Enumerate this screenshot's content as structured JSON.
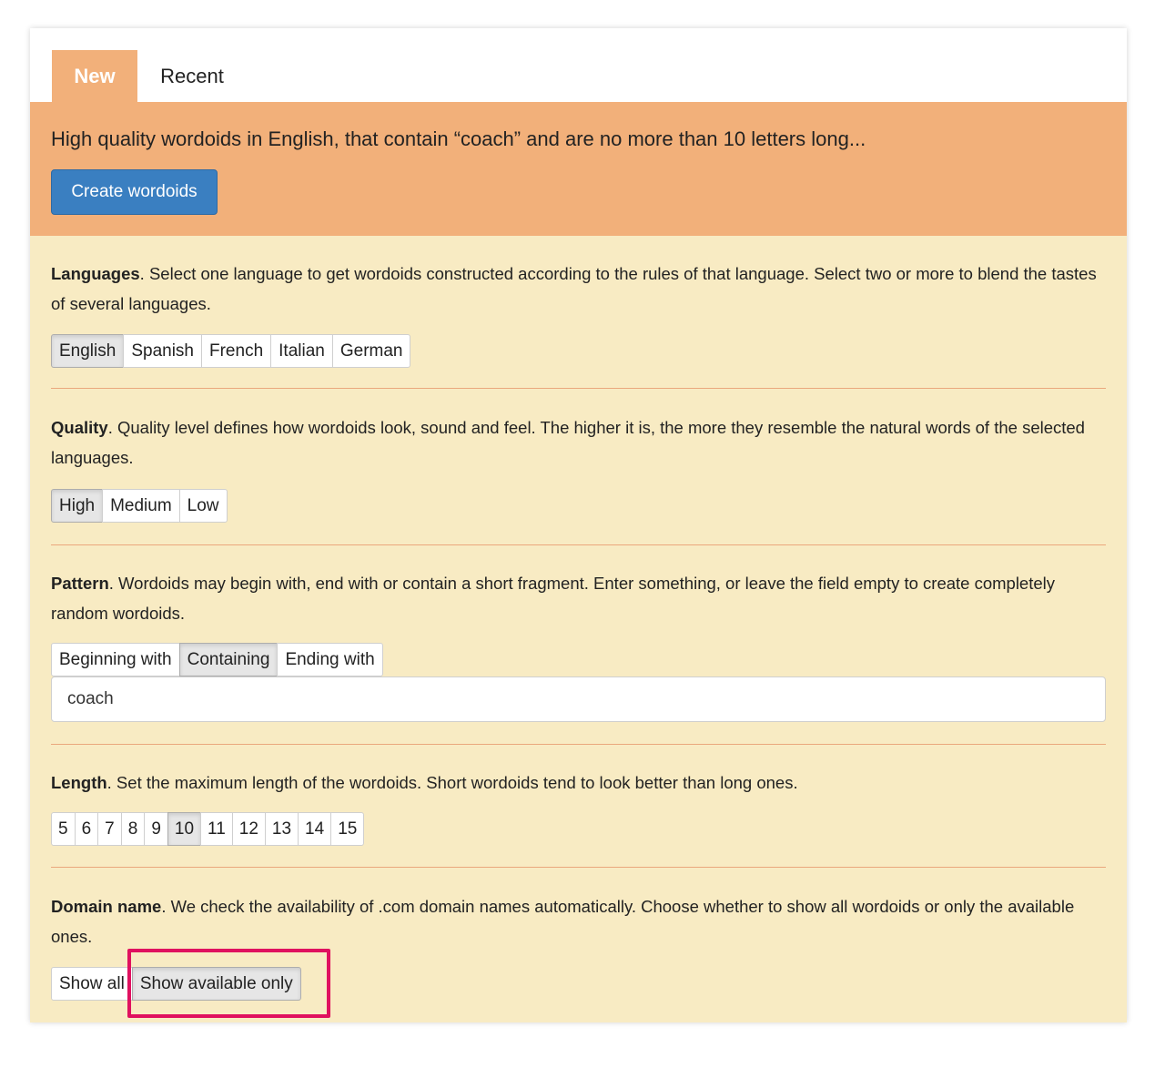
{
  "tabs": [
    {
      "label": "New",
      "active": true
    },
    {
      "label": "Recent",
      "active": false
    }
  ],
  "banner": {
    "summary": "High quality wordoids in English, that contain “coach” and are no more than 10 letters long...",
    "create_label": "Create wordoids"
  },
  "languages": {
    "title": "Languages",
    "description": ". Select one language to get wordoids constructed according to the rules of that language. Select two or more to blend the tastes of several languages.",
    "options": [
      "English",
      "Spanish",
      "French",
      "Italian",
      "German"
    ],
    "selected": "English"
  },
  "quality": {
    "title": "Quality",
    "description": ". Quality level defines how wordoids look, sound and feel. The higher it is, the more they resemble the natural words of the selected languages.",
    "options": [
      "High",
      "Medium",
      "Low"
    ],
    "selected": "High"
  },
  "pattern": {
    "title": "Pattern",
    "description": ". Wordoids may begin with, end with or contain a short fragment. Enter something, or leave the field empty to create completely random wordoids.",
    "options": [
      "Beginning with",
      "Containing",
      "Ending with"
    ],
    "selected": "Containing",
    "value": "coach"
  },
  "length": {
    "title": "Length",
    "description": ". Set the maximum length of the wordoids. Short wordoids tend to look better than long ones.",
    "options": [
      "5",
      "6",
      "7",
      "8",
      "9",
      "10",
      "11",
      "12",
      "13",
      "14",
      "15"
    ],
    "selected": "10"
  },
  "domain": {
    "title": "Domain name",
    "description": ". We check the availability of .com domain names automatically. Choose whether to show all wordoids or only the available ones.",
    "options": [
      "Show all",
      "Show available only"
    ],
    "selected": "Show available only"
  },
  "colors": {
    "accent_orange": "#f2b07a",
    "panel_cream": "#f8ebc3",
    "primary_blue": "#3a7fc1",
    "highlight_red": "#e0115f"
  }
}
